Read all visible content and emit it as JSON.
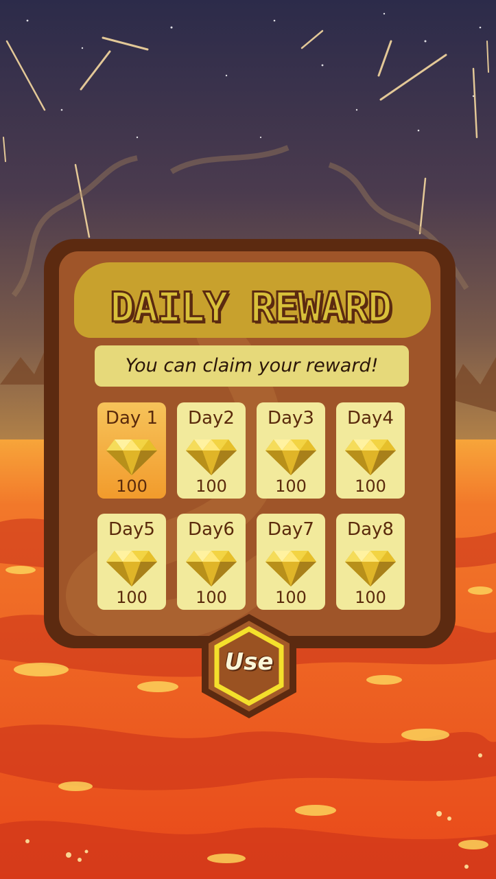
{
  "screen": {
    "title": "DAILY REWARD",
    "subtitle": "You can claim your reward!"
  },
  "rewards": [
    {
      "label": "Day 1",
      "amount": "100",
      "icon": "diamond-icon",
      "active": true
    },
    {
      "label": "Day2",
      "amount": "100",
      "icon": "diamond-icon",
      "active": false
    },
    {
      "label": "Day3",
      "amount": "100",
      "icon": "diamond-icon",
      "active": false
    },
    {
      "label": "Day4",
      "amount": "100",
      "icon": "diamond-icon",
      "active": false
    },
    {
      "label": "Day5",
      "amount": "100",
      "icon": "diamond-icon",
      "active": false
    },
    {
      "label": "Day6",
      "amount": "100",
      "icon": "diamond-icon",
      "active": false
    },
    {
      "label": "Day7",
      "amount": "100",
      "icon": "diamond-icon",
      "active": false
    },
    {
      "label": "Day8",
      "amount": "100",
      "icon": "diamond-icon",
      "active": false
    }
  ],
  "actions": {
    "use_label": "Use"
  },
  "colors": {
    "panel_border": "#5c2a10",
    "panel_fill": "#9f5529",
    "title_band": "#c8a12d",
    "card_fill": "#f2ea9c",
    "card_active": "#f29b2c",
    "lava": "#f0561c",
    "sky_top": "#2c2b4a"
  }
}
